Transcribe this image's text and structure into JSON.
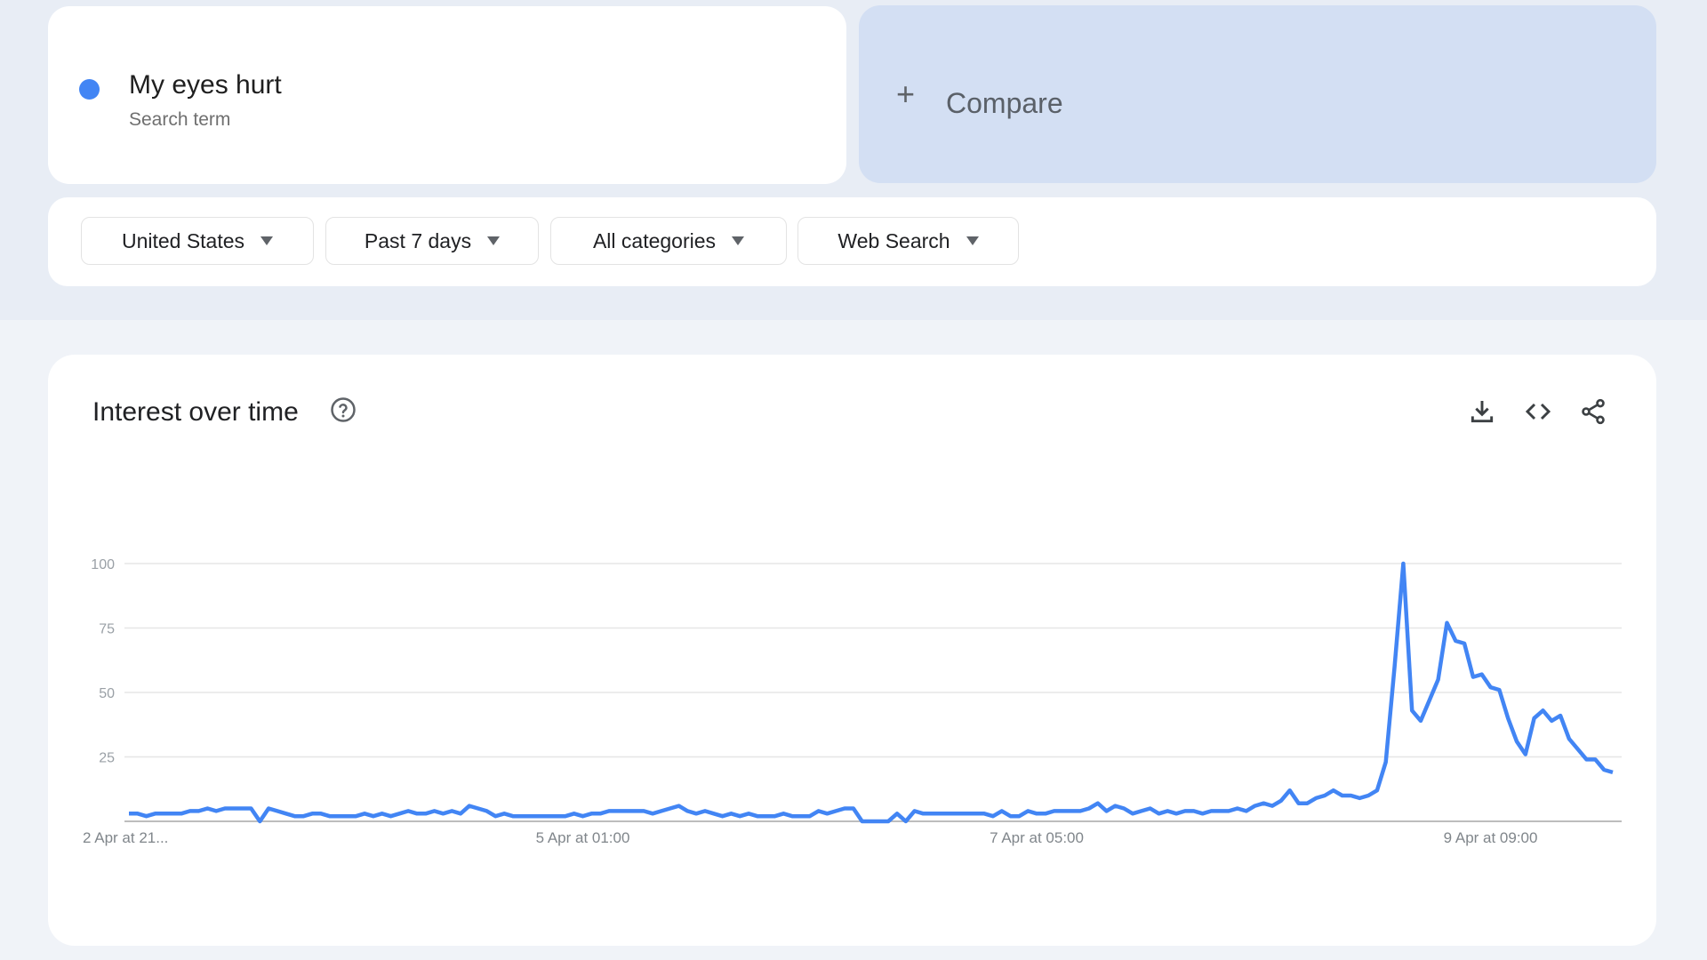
{
  "search_term": {
    "name": "My eyes hurt",
    "type_label": "Search term",
    "color": "#4285f4"
  },
  "compare": {
    "label": "Compare",
    "icon": "plus-icon"
  },
  "filters": [
    {
      "label": "United States",
      "icon": "caret-down-icon"
    },
    {
      "label": "Past 7 days",
      "icon": "caret-down-icon"
    },
    {
      "label": "All categories",
      "icon": "caret-down-icon"
    },
    {
      "label": "Web Search",
      "icon": "caret-down-icon"
    }
  ],
  "panel": {
    "title": "Interest over time",
    "help_icon": "help-circle-icon",
    "actions": [
      {
        "name": "download-icon"
      },
      {
        "name": "embed-code-icon"
      },
      {
        "name": "share-icon"
      }
    ]
  },
  "chart_data": {
    "type": "line",
    "title": "Interest over time",
    "xlabel": "",
    "ylabel": "",
    "ylim": [
      0,
      100
    ],
    "yticks": [
      "100",
      "75",
      "50",
      "25"
    ],
    "ytick_values": [
      100,
      75,
      50,
      25
    ],
    "grid": true,
    "legend": "none",
    "x_tick_labels": [
      {
        "label": "2 Apr at 21...",
        "index": 0
      },
      {
        "label": "5 Apr at 01:00",
        "index": 52
      },
      {
        "label": "7 Apr at 05:00",
        "index": 104
      },
      {
        "label": "9 Apr at 09:00",
        "index": 156
      }
    ],
    "x_interval": "hourly",
    "series": [
      {
        "name": "My eyes hurt",
        "color": "#4285f4",
        "values": [
          3,
          3,
          2,
          3,
          3,
          3,
          3,
          4,
          4,
          5,
          4,
          5,
          5,
          5,
          5,
          0,
          5,
          4,
          3,
          2,
          2,
          3,
          3,
          2,
          2,
          2,
          2,
          3,
          2,
          3,
          2,
          3,
          4,
          3,
          3,
          4,
          3,
          4,
          3,
          6,
          5,
          4,
          2,
          3,
          2,
          2,
          2,
          2,
          2,
          2,
          2,
          3,
          2,
          3,
          3,
          4,
          4,
          4,
          4,
          4,
          3,
          4,
          5,
          6,
          4,
          3,
          4,
          3,
          2,
          3,
          2,
          3,
          2,
          2,
          2,
          3,
          2,
          2,
          2,
          4,
          3,
          4,
          5,
          5,
          0,
          0,
          0,
          0,
          3,
          0,
          4,
          3,
          3,
          3,
          3,
          3,
          3,
          3,
          3,
          2,
          4,
          2,
          2,
          4,
          3,
          3,
          4,
          4,
          4,
          4,
          5,
          7,
          4,
          6,
          5,
          3,
          4,
          5,
          3,
          4,
          3,
          4,
          4,
          3,
          4,
          4,
          4,
          5,
          4,
          6,
          7,
          6,
          8,
          12,
          7,
          7,
          9,
          10,
          12,
          10,
          10,
          9,
          10,
          12,
          23,
          60,
          100,
          43,
          39,
          47,
          55,
          77,
          70,
          69,
          56,
          57,
          52,
          51,
          40,
          31,
          26,
          40,
          43,
          39,
          41,
          32,
          28,
          24,
          24,
          20,
          19
        ]
      }
    ]
  }
}
